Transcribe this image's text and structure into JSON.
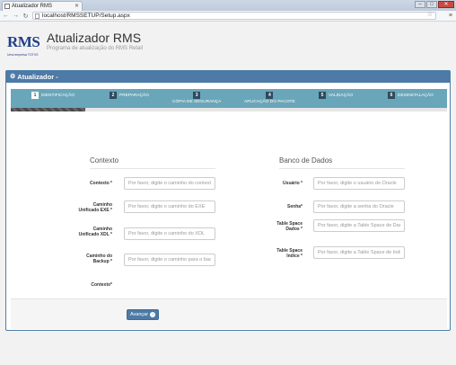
{
  "browser": {
    "tab_title": "Atualizador RMS",
    "url": "localhost/RMSSETUP/Setup.aspx"
  },
  "header": {
    "logo_text": "RMS",
    "logo_tagline": "Uma empresa TOTVS",
    "title": "Atualizador RMS",
    "subtitle": "Programa de atualização do RMS Retail"
  },
  "panel": {
    "heading": "Atualizador -"
  },
  "wizard": {
    "progress": 0.17,
    "steps": [
      {
        "num": "1",
        "label": "IDENTIFICAÇÃO",
        "active": true
      },
      {
        "num": "2",
        "label": "PREPARAÇÃO",
        "active": false
      },
      {
        "num": "3",
        "label": "CÓPIA DE SEGURANÇA",
        "active": false
      },
      {
        "num": "4",
        "label": "APLICAÇÃO DO PACOTE",
        "active": false
      },
      {
        "num": "5",
        "label": "VALIDAÇÃO",
        "active": false
      },
      {
        "num": "6",
        "label": "DESINSTALAÇÃO",
        "active": false
      }
    ]
  },
  "contexto": {
    "title": "Contexto",
    "fields": [
      {
        "label": "Contexto *",
        "placeholder": "Por favor, digite o caminho do contexto"
      },
      {
        "label": "Caminho Unificado EXE *",
        "placeholder": "Por favor, digite o caminho do EXE"
      },
      {
        "label": "Caminho Unificado XDL *",
        "placeholder": "Por favor, digite o caminho do XDL"
      },
      {
        "label": "Caminho do Backup *",
        "placeholder": "Por favor, digite o caminho para o backup"
      }
    ],
    "extra_label": "Contexto*"
  },
  "banco": {
    "title": "Banco de Dados",
    "fields": [
      {
        "label": "Usuário *",
        "placeholder": "Por favor, digite o usuário do Oracle"
      },
      {
        "label": "Senha*",
        "placeholder": "Por favor, digite a senha do Oracle"
      },
      {
        "label": "Table Space Dados *",
        "placeholder": "Por favor, digite a Table Space de Dados"
      },
      {
        "label": "Table Space Indice *",
        "placeholder": "Por favor, digite a Table Space de Indice"
      }
    ]
  },
  "actions": {
    "next_label": "Avançar"
  }
}
